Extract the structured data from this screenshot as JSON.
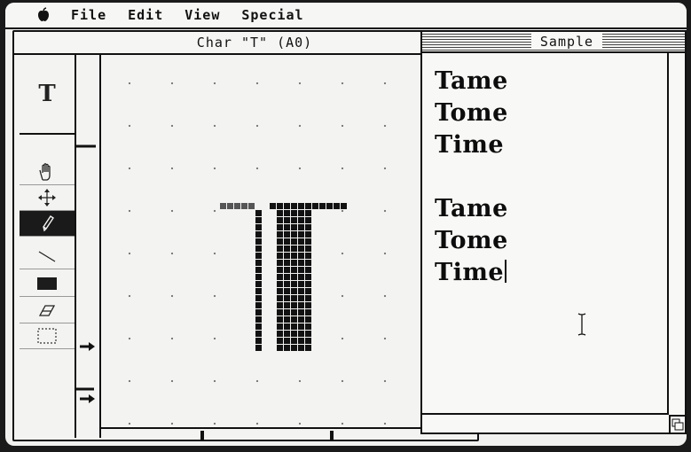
{
  "menubar": {
    "items": [
      "File",
      "Edit",
      "View",
      "Special"
    ]
  },
  "editor": {
    "title": "Char \"T\" (A0)",
    "preview_glyph": "T",
    "tools": [
      "hand-tool",
      "move-tool",
      "pencil-tool",
      "line-tool",
      "fill-rect-tool",
      "eraser-tool",
      "selection-tool"
    ],
    "selected_tool": "pencil-tool"
  },
  "sample": {
    "title": "Sample",
    "lines": [
      "Tame",
      "Tome",
      "Time",
      "",
      "Tame",
      "Tome",
      "Time"
    ]
  },
  "colors": {
    "screen": "#f1f1ef",
    "ink": "#111111",
    "bezel": "#1a1a1a"
  }
}
